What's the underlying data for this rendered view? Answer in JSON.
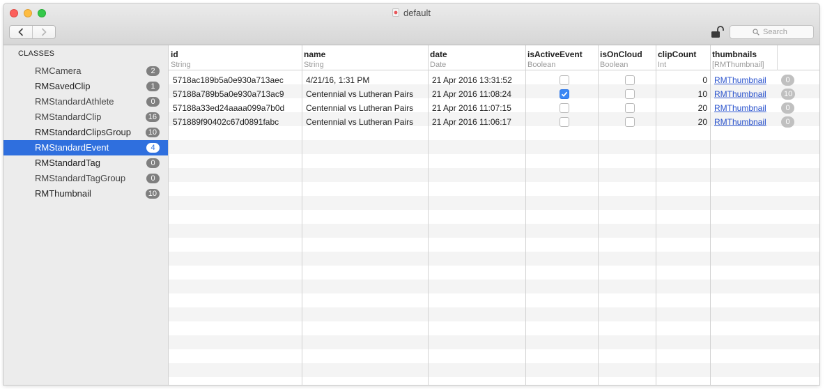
{
  "window": {
    "title": "default"
  },
  "toolbar": {
    "back_label": "‹",
    "forward_label": "›",
    "search_placeholder": "Search"
  },
  "sidebar": {
    "header": "CLASSES",
    "items": [
      {
        "label": "RMCamera",
        "count": "2",
        "selected": false
      },
      {
        "label": "RMSavedClip",
        "count": "1",
        "selected": false
      },
      {
        "label": "RMStandardAthlete",
        "count": "0",
        "selected": false
      },
      {
        "label": "RMStandardClip",
        "count": "16",
        "selected": false
      },
      {
        "label": "RMStandardClipsGroup",
        "count": "10",
        "selected": false
      },
      {
        "label": "RMStandardEvent",
        "count": "4",
        "selected": true
      },
      {
        "label": "RMStandardTag",
        "count": "0",
        "selected": false
      },
      {
        "label": "RMStandardTagGroup",
        "count": "0",
        "selected": false
      },
      {
        "label": "RMThumbnail",
        "count": "10",
        "selected": false
      }
    ]
  },
  "table": {
    "columns": [
      {
        "name": "id",
        "type": "String"
      },
      {
        "name": "name",
        "type": "String"
      },
      {
        "name": "date",
        "type": "Date"
      },
      {
        "name": "isActiveEvent",
        "type": "Boolean"
      },
      {
        "name": "isOnCloud",
        "type": "Boolean"
      },
      {
        "name": "clipCount",
        "type": "Int"
      },
      {
        "name": "thumbnails",
        "type": "[RMThumbnail]"
      }
    ],
    "rows": [
      {
        "id": "5718ac189b5a0e930a713aec",
        "name": "4/21/16, 1:31 PM",
        "date": "21 Apr 2016 13:31:52",
        "isActiveEvent": false,
        "isOnCloud": false,
        "clipCount": "0",
        "thumbnails": "RMThumbnail",
        "thumb_count": "0"
      },
      {
        "id": "57188a789b5a0e930a713ac9",
        "name": "Centennial vs Lutheran Pairs",
        "date": "21 Apr 2016 11:08:24",
        "isActiveEvent": true,
        "isOnCloud": false,
        "clipCount": "10",
        "thumbnails": "RMThumbnail",
        "thumb_count": "10"
      },
      {
        "id": "57188a33ed24aaaa099a7b0d",
        "name": "Centennial vs Lutheran Pairs",
        "date": "21 Apr 2016 11:07:15",
        "isActiveEvent": false,
        "isOnCloud": false,
        "clipCount": "20",
        "thumbnails": "RMThumbnail",
        "thumb_count": "0"
      },
      {
        "id": "571889f90402c67d0891fabc",
        "name": "Centennial vs Lutheran Pairs",
        "date": "21 Apr 2016 11:06:17",
        "isActiveEvent": false,
        "isOnCloud": false,
        "clipCount": "20",
        "thumbnails": "RMThumbnail",
        "thumb_count": "0"
      }
    ]
  },
  "colors": {
    "selection": "#2f6fde",
    "checkbox_checked": "#3b87f4",
    "link": "#2a53cd"
  }
}
